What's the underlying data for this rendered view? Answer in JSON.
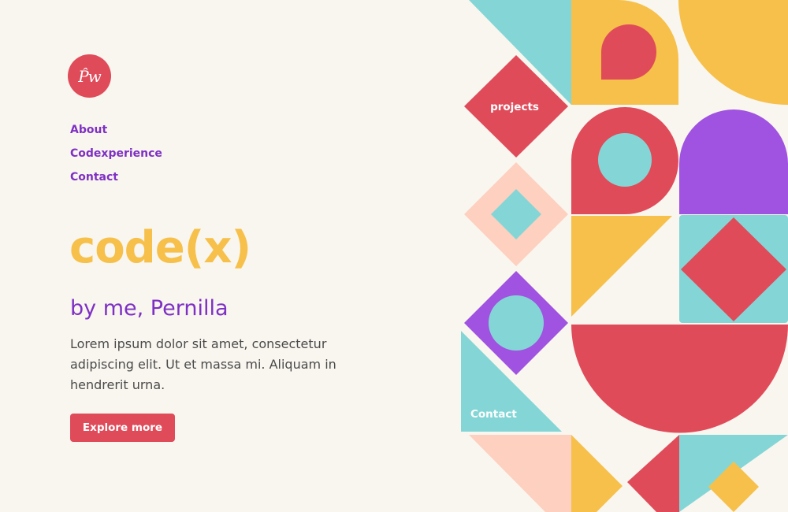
{
  "logo": {
    "text": "P̂w",
    "color": "#e04b5a"
  },
  "nav": {
    "items": [
      {
        "label": "About"
      },
      {
        "label": "Codexperience"
      },
      {
        "label": "Contact"
      }
    ]
  },
  "hero": {
    "title": "code(x)",
    "subtitle": "by me, Pernilla",
    "body": "Lorem ipsum dolor sit amet, consectetur adipiscing elit. Ut et massa mi. Aliquam in hendrerit urna.",
    "cta_label": "Explore more"
  },
  "art": {
    "projects_label": "projects",
    "contact_label": "Contact"
  },
  "colors": {
    "background": "#f9f6ef",
    "purple": "#7e30c4",
    "yellow": "#f6c04a",
    "red": "#e04b5a",
    "teal": "#84d6d6",
    "peach": "#fdd0c0",
    "violet": "#a052e0"
  }
}
